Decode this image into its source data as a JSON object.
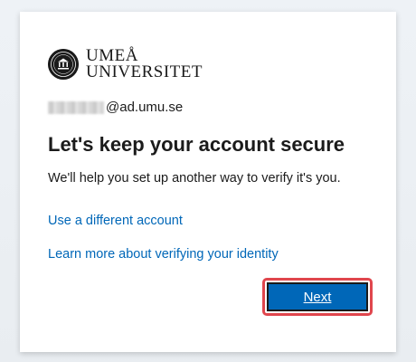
{
  "logo": {
    "line1": "UMEÅ",
    "line2": "UNIVERSITET",
    "seal_icon": "university-seal-icon"
  },
  "identity": {
    "username_redacted": true,
    "domain": "@ad.umu.se"
  },
  "title": "Let's keep your account secure",
  "description": "We'll help you set up another way to verify it's you.",
  "links": {
    "different_account": "Use a different account",
    "learn_more": "Learn more about verifying your identity"
  },
  "buttons": {
    "next": "Next"
  },
  "colors": {
    "accent": "#0067b8",
    "link": "#0067b8",
    "highlight": "#e0464d",
    "text": "#1b1b1b"
  }
}
